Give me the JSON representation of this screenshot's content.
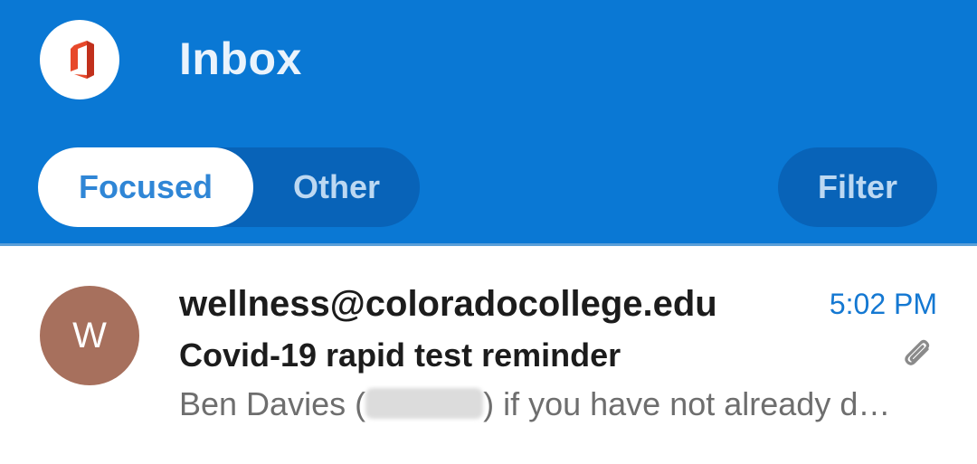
{
  "header": {
    "title": "Inbox",
    "logo_icon": "office-logo-icon",
    "tabs": [
      {
        "label": "Focused",
        "selected": true
      },
      {
        "label": "Other",
        "selected": false
      }
    ],
    "filter_label": "Filter",
    "colors": {
      "header_bg": "#0a78d4",
      "accent": "#1478d2"
    }
  },
  "messages": [
    {
      "avatar_letter": "W",
      "avatar_color": "#a7705d",
      "sender": "wellness@coloradocollege.edu",
      "time": "5:02 PM",
      "subject": "Covid-19 rapid test reminder",
      "has_attachment": true,
      "attachment_icon": "paperclip-icon",
      "preview_before": "Ben Davies (",
      "preview_after": ") if you have not already d…"
    }
  ]
}
